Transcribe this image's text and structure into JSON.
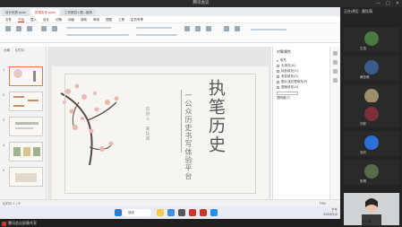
{
  "meeting": {
    "title": "腾讯会议",
    "sharing_label": "腾讯会议屏幕共享"
  },
  "wps": {
    "tabs": [
      {
        "label": "设计优秀 pptx"
      },
      {
        "label": "执笔历史.pptx"
      },
      {
        "label": "工作报告1.剧...副本"
      }
    ],
    "menu": [
      {
        "label": "文件"
      },
      {
        "label": "开始"
      },
      {
        "label": "插入"
      },
      {
        "label": "设计"
      },
      {
        "label": "切换"
      },
      {
        "label": "动画"
      },
      {
        "label": "放映"
      },
      {
        "label": "审阅"
      },
      {
        "label": "视图"
      },
      {
        "label": "工具"
      },
      {
        "label": "会员专享"
      }
    ],
    "thumb_tabs": [
      "大纲",
      "幻灯片"
    ],
    "slide": {
      "title": "执笔历史",
      "subtitle": "一公众历史书写体验平台",
      "author": "答辩人：黄钰萌"
    },
    "right_pane": {
      "title": "对象属性",
      "section": "填充",
      "options": [
        "无填充(N)",
        "纯色填充(S)",
        "渐变填充(G)",
        "图片或纹理填充(P)",
        "图案填充(A)"
      ],
      "note": "透明度(T)"
    },
    "status": {
      "left": "幻灯片 1 / 9",
      "zoom": "79%"
    },
    "taskbar": {
      "search": "搜索",
      "clock_time": "下午",
      "clock_date": "2023/5/2"
    }
  },
  "participants": {
    "header": "正在讲话：黄钰萌",
    "list": [
      {
        "name": "王浩",
        "color": "#4a7a3f"
      },
      {
        "name": "黄钰萌",
        "color": "#3b5b8a"
      },
      {
        "name": "高雯",
        "color": "#9a8f6a"
      },
      {
        "name": "刘彬",
        "color": "#7a2f3a"
      },
      {
        "name": "邓雪",
        "color": "#2f2f2f"
      },
      {
        "name": "安欣",
        "color": "#2d6fd8"
      },
      {
        "name": "张桐",
        "color": "#556b4a"
      }
    ],
    "camera_name": "黄钰萌"
  }
}
